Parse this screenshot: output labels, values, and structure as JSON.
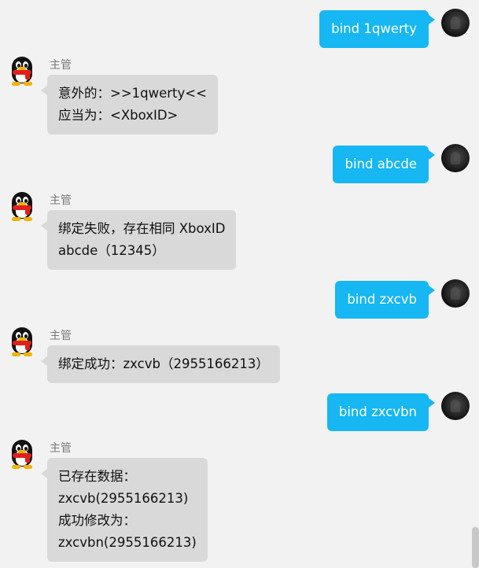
{
  "chat": {
    "messages": [
      {
        "direction": "out",
        "text": "bind 1qwerty"
      },
      {
        "direction": "in",
        "sender": "主管",
        "lines": [
          "意外的：>>1qwerty<<",
          "应当为：<XboxID>"
        ]
      },
      {
        "direction": "out",
        "text": "bind abcde"
      },
      {
        "direction": "in",
        "sender": "主管",
        "lines": [
          "绑定失败，存在相同 XboxID",
          "abcde（12345）"
        ]
      },
      {
        "direction": "out",
        "text": "bind zxcvb"
      },
      {
        "direction": "in",
        "sender": "主管",
        "lines": [
          "绑定成功：zxcvb（2955166213）"
        ]
      },
      {
        "direction": "out",
        "text": "bind zxcvbn"
      },
      {
        "direction": "in",
        "sender": "主管",
        "lines": [
          "已存在数据：",
          "zxcvb(2955166213)",
          "成功修改为：",
          "zxcvbn(2955166213)"
        ]
      }
    ]
  },
  "colors": {
    "background": "#f2f2f2",
    "outgoing_bubble": "#16b7f2",
    "incoming_bubble": "#d9d9d9"
  },
  "icons": {
    "self_avatar": "dark-avatar-icon",
    "bot_avatar": "qq-penguin-icon"
  }
}
